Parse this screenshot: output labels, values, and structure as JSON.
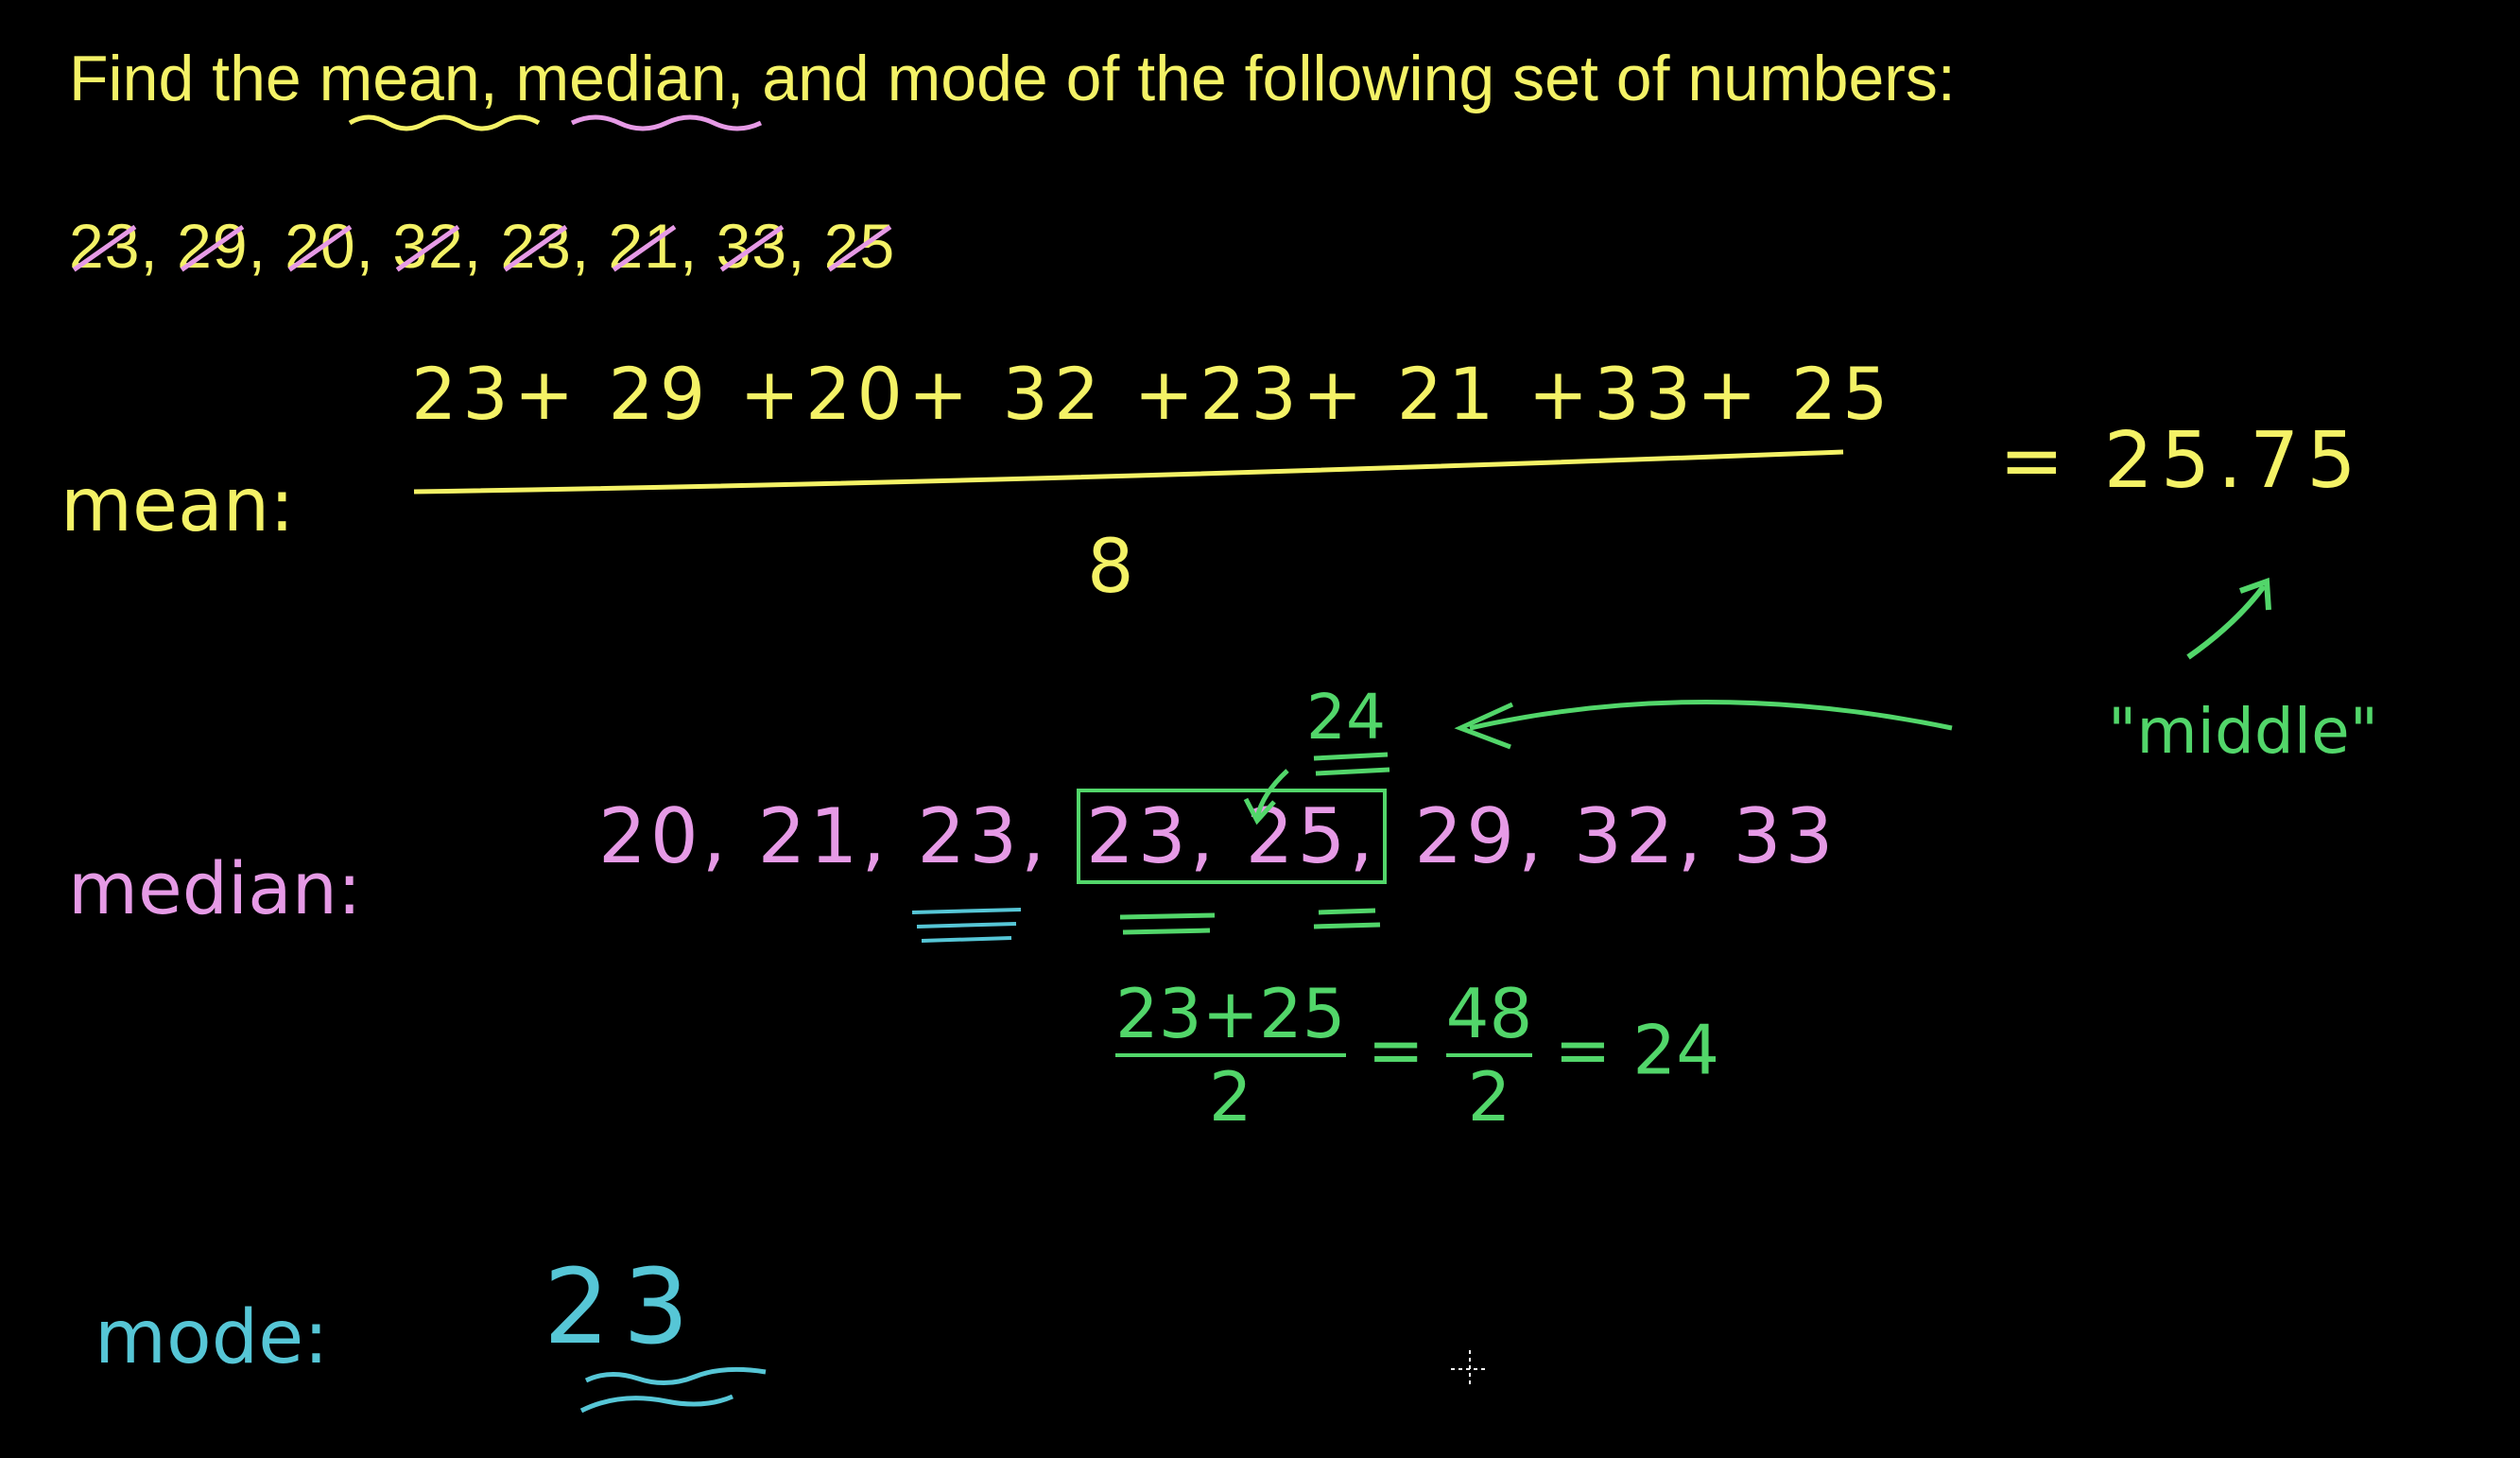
{
  "title": "Find the mean, median, and mode of the following set of numbers:",
  "numbers": [
    {
      "value": "23",
      "strike": true
    },
    {
      "value": "29",
      "strike": true
    },
    {
      "value": "20",
      "strike": true
    },
    {
      "value": "32",
      "strike": true
    },
    {
      "value": "23",
      "strike": true
    },
    {
      "value": "21",
      "strike": true
    },
    {
      "value": "33",
      "strike": true
    },
    {
      "value": "25",
      "strike": true
    }
  ],
  "mean": {
    "label": "mean:",
    "numerator": "23+ 29 +20+ 32 +23+ 21 +33+ 25",
    "denominator": "8",
    "result": "= 25.75"
  },
  "middle_note": "\"middle\"",
  "median": {
    "label": "median:",
    "sorted_before": "20, 21, 23,",
    "boxed": "23, 25,",
    "sorted_after": "29, 32, 33",
    "value": "24",
    "calc_num": "23+25",
    "calc_den": "2",
    "calc_eq": "=",
    "calc_num2": "48",
    "calc_den2": "2",
    "calc_result": "= 24"
  },
  "mode": {
    "label": "mode:",
    "value": "23"
  },
  "colors": {
    "background": "#000000",
    "yellow": "#f4f266",
    "pink": "#e69ae6",
    "green": "#52d66a",
    "blue": "#56c6d6"
  }
}
